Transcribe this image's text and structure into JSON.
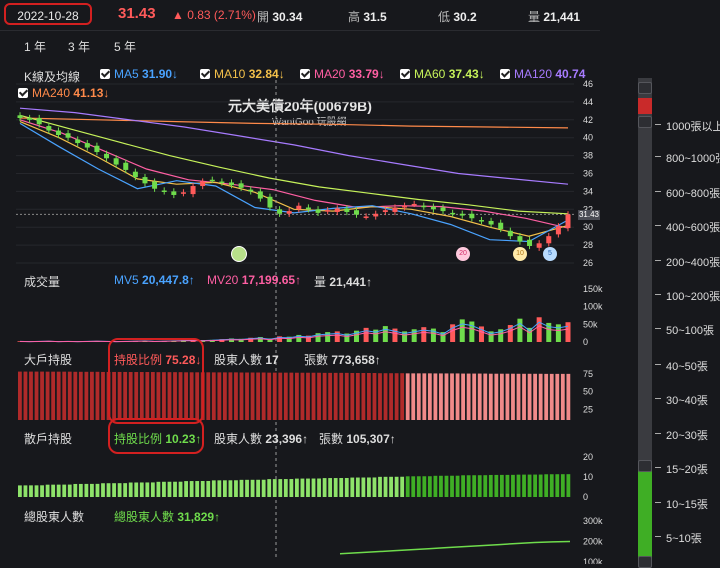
{
  "header": {
    "date": "2022-10-28",
    "price": "31.43",
    "change": "▲ 0.83 (2.71%)",
    "open_label": "開",
    "open": "30.34",
    "high_label": "高",
    "high": "31.5",
    "low_label": "低",
    "low": "30.2",
    "vol_label": "量",
    "vol": "21,441"
  },
  "ranges": [
    "1 年",
    "3 年",
    "5 年"
  ],
  "kline": {
    "label": "K線及均線",
    "title": "元大美債20年(00679B)",
    "subtitle": "WantGoo 玩股網",
    "ma": [
      {
        "name": "MA5",
        "value": "31.90↓",
        "color": "#4aa3ff"
      },
      {
        "name": "MA10",
        "value": "32.84↓",
        "color": "#f3c04a"
      },
      {
        "name": "MA20",
        "value": "33.79↓",
        "color": "#ff5fa3"
      },
      {
        "name": "MA60",
        "value": "37.43↓",
        "color": "#c6f25a"
      },
      {
        "name": "MA120",
        "value": "40.74",
        "color": "#a77bff"
      },
      {
        "name": "MA240",
        "value": "41.13↓",
        "color": "#ff8a4a"
      }
    ],
    "yticks": [
      "46",
      "44",
      "42",
      "40",
      "38",
      "36",
      "34",
      "32",
      "30",
      "28",
      "26"
    ],
    "last_badge": "31.43",
    "markers": [
      "20",
      "10",
      "5"
    ]
  },
  "volume": {
    "label": "成交量",
    "mv5_label": "MV5",
    "mv5": "20,447.8↑",
    "mv20_label": "MV20",
    "mv20": "17,199.65↑",
    "vol_label": "量",
    "vol": "21,441↑",
    "yticks": [
      "150k",
      "100k",
      "50k",
      "0"
    ]
  },
  "big_holders": {
    "label": "大戶持股",
    "ratio_label": "持股比例",
    "ratio": "75.28↓",
    "holders_label": "股東人數",
    "holders": "17",
    "shares_label": "張數",
    "shares": "773,658↑",
    "yticks": [
      "75",
      "50",
      "25"
    ]
  },
  "small_holders": {
    "label": "散戶持股",
    "ratio_label": "持股比例",
    "ratio": "10.23↑",
    "holders_label": "股東人數",
    "holders": "23,396↑",
    "shares_label": "張數",
    "shares": "105,307↑",
    "yticks": [
      "20",
      "10",
      "0"
    ]
  },
  "total_holders": {
    "label": "總股東人數",
    "name": "總股東人數",
    "value": "31,829↑",
    "yticks": [
      "300k",
      "200k",
      "100k"
    ]
  },
  "scale": [
    "1000張以上",
    "800~1000張",
    "600~800張",
    "400~600張",
    "200~400張",
    "100~200張",
    "50~100張",
    "40~50張",
    "30~40張",
    "20~30張",
    "15~20張",
    "10~15張",
    "5~10張"
  ],
  "chart_data": {
    "type": "line",
    "title": "元大美債20年(00679B)",
    "ylim": [
      26,
      46
    ],
    "ma": {
      "MA5": 31.9,
      "MA10": 32.84,
      "MA20": 33.79,
      "MA60": 37.43,
      "MA120": 40.74,
      "MA240": 41.13
    },
    "close_series": [
      42.2,
      42.0,
      41.5,
      40.8,
      40.3,
      40.0,
      39.4,
      38.9,
      38.4,
      37.7,
      37.0,
      36.4,
      35.6,
      34.9,
      34.3,
      34.0,
      33.6,
      33.9,
      34.6,
      35.1,
      35.3,
      35.0,
      34.7,
      34.4,
      34.0,
      33.2,
      32.2,
      31.5,
      31.8,
      32.4,
      32.0,
      31.6,
      31.9,
      32.1,
      31.7,
      31.4,
      31.2,
      31.5,
      31.9,
      32.2,
      32.4,
      32.6,
      32.3,
      32.0,
      31.8,
      31.5,
      31.3,
      31.0,
      30.7,
      30.3,
      29.8,
      29.0,
      28.4,
      27.9,
      28.2,
      29.0,
      30.1,
      31.43
    ],
    "volume_k": [
      2,
      1,
      2,
      3,
      1,
      2,
      1,
      2,
      3,
      2,
      1,
      2,
      3,
      4,
      2,
      3,
      4,
      5,
      6,
      5,
      6,
      8,
      10,
      9,
      12,
      14,
      10,
      16,
      15,
      20,
      18,
      25,
      28,
      30,
      24,
      32,
      40,
      35,
      45,
      38,
      30,
      36,
      42,
      38,
      28,
      50,
      64,
      58,
      44,
      30,
      36,
      48,
      66,
      40,
      70,
      54,
      50,
      56
    ],
    "big_holder_ratio": [
      78.5,
      78.4,
      78.2,
      78.0,
      77.9,
      77.7,
      77.5,
      77.4,
      77.2,
      77.0,
      76.9,
      76.7,
      76.5,
      76.2,
      76.0,
      75.9,
      75.7,
      75.5,
      75.4,
      75.28
    ],
    "small_holder_ratio": [
      5.8,
      6.1,
      6.4,
      6.7,
      7.0,
      7.3,
      7.6,
      7.9,
      8.1,
      8.4,
      8.6,
      8.8,
      9.0,
      9.3,
      9.5,
      9.7,
      9.9,
      10.0,
      10.1,
      10.23
    ],
    "total_holders_k": [
      140,
      145,
      150,
      155,
      160,
      165,
      170,
      175,
      180,
      185,
      190,
      195,
      198,
      200
    ]
  }
}
